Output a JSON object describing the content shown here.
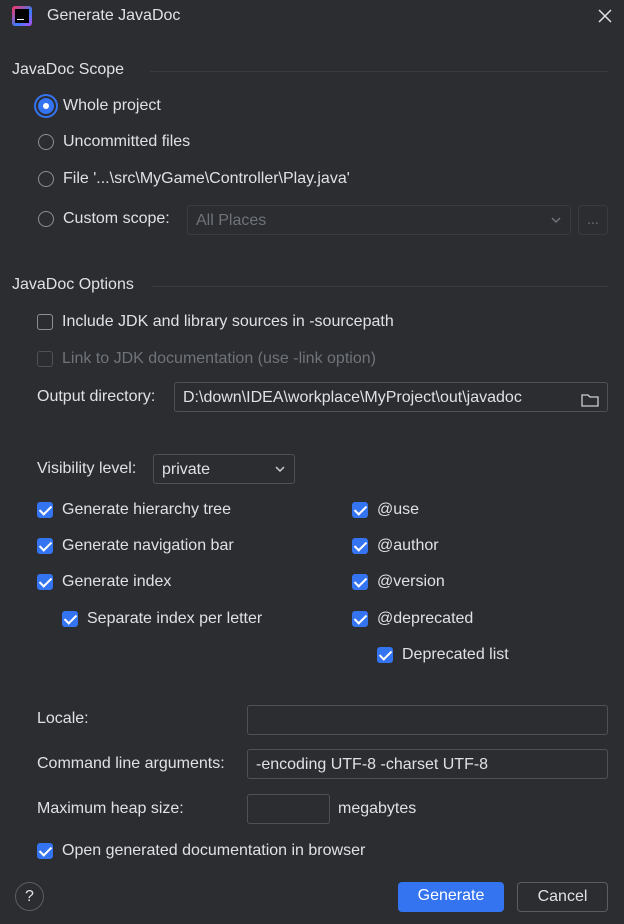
{
  "window": {
    "title": "Generate JavaDoc"
  },
  "scope": {
    "heading": "JavaDoc Scope",
    "whole_project": "Whole project",
    "uncommitted_files": "Uncommitted files",
    "file": "File '...\\src\\MyGame\\Controller\\Play.java'",
    "custom_scope": "Custom scope:",
    "custom_scope_value": "All Places",
    "browse_label": "..."
  },
  "options": {
    "heading": "JavaDoc Options",
    "include_jdk": "Include JDK and library sources in -sourcepath",
    "link_jdk": "Link to JDK documentation (use -link option)",
    "output_dir_label": "Output directory:",
    "output_dir_value": "D:\\down\\IDEA\\workplace\\MyProject\\out\\javadoc",
    "visibility_label": "Visibility level:",
    "visibility_value": "private",
    "gen_hierarchy": "Generate hierarchy tree",
    "gen_navbar": "Generate navigation bar",
    "gen_index": "Generate index",
    "separate_index": "Separate index per letter",
    "use_tag": "@use",
    "author_tag": "@author",
    "version_tag": "@version",
    "deprecated_tag": "@deprecated",
    "deprecated_list": "Deprecated list",
    "locale_label": "Locale:",
    "locale_value": "",
    "cmd_args_label": "Command line arguments:",
    "cmd_args_value": "-encoding UTF-8 -charset UTF-8",
    "heap_label": "Maximum heap size:",
    "heap_value": "",
    "heap_unit": "megabytes",
    "open_browser": "Open generated documentation in browser"
  },
  "footer": {
    "help": "?",
    "generate": "Generate",
    "cancel": "Cancel"
  },
  "colors": {
    "accent": "#3574f0",
    "background": "#2b2d30"
  }
}
